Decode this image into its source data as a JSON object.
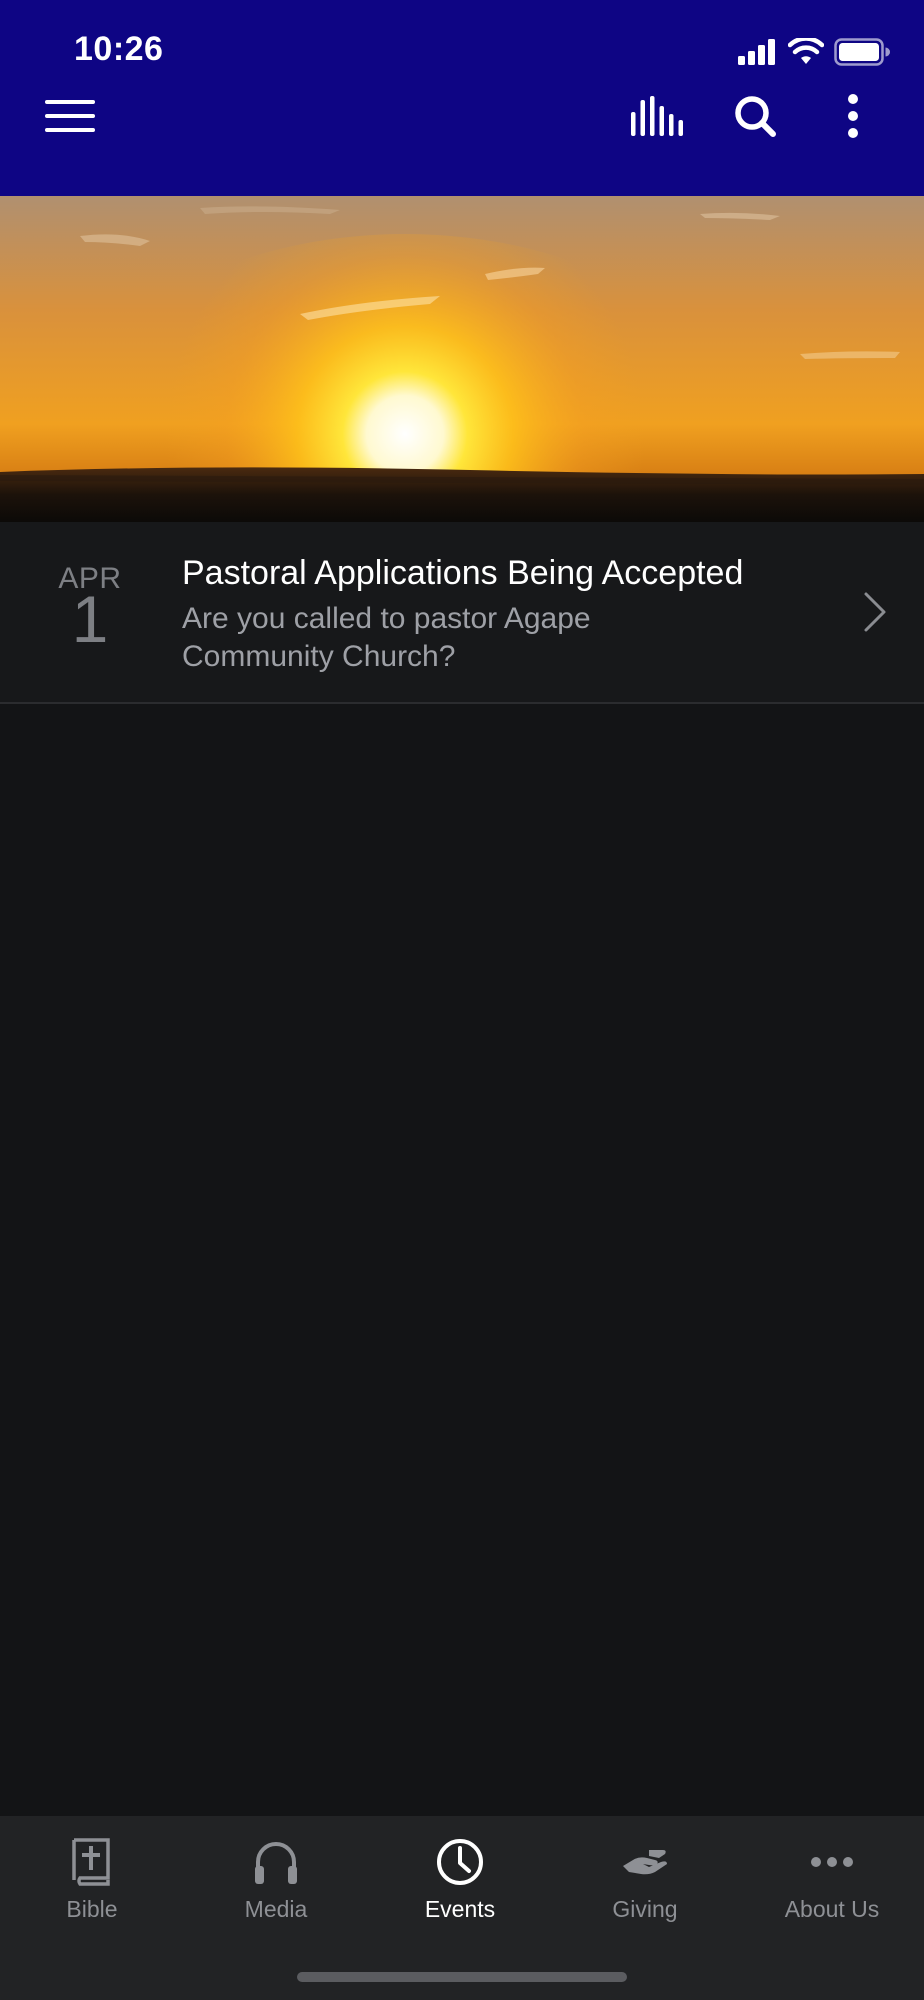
{
  "status_bar": {
    "time": "10:26"
  },
  "header": {
    "menu_icon": "hamburger-menu-icon",
    "actions": [
      "audio-bars-icon",
      "search-icon",
      "more-vertical-icon"
    ],
    "background_color": "#0e0584"
  },
  "hero": {
    "description": "sunset banner"
  },
  "events": [
    {
      "month": "APR",
      "day": "1",
      "title": "Pastoral Applications Being Accepted",
      "description": "Are you called to pastor Agape Community Church?"
    }
  ],
  "tabbar": {
    "active_tab": "Events",
    "tabs": [
      {
        "label": "Bible",
        "icon": "bible-icon"
      },
      {
        "label": "Media",
        "icon": "headphones-icon"
      },
      {
        "label": "Events",
        "icon": "clock-icon"
      },
      {
        "label": "Giving",
        "icon": "giving-hand-icon"
      },
      {
        "label": "About Us",
        "icon": "more-horizontal-icon"
      }
    ]
  },
  "colors": {
    "background": "#131416",
    "tabbar": "#222325",
    "active_tab": "#ffffff",
    "inactive_tab": "#8e9095"
  }
}
